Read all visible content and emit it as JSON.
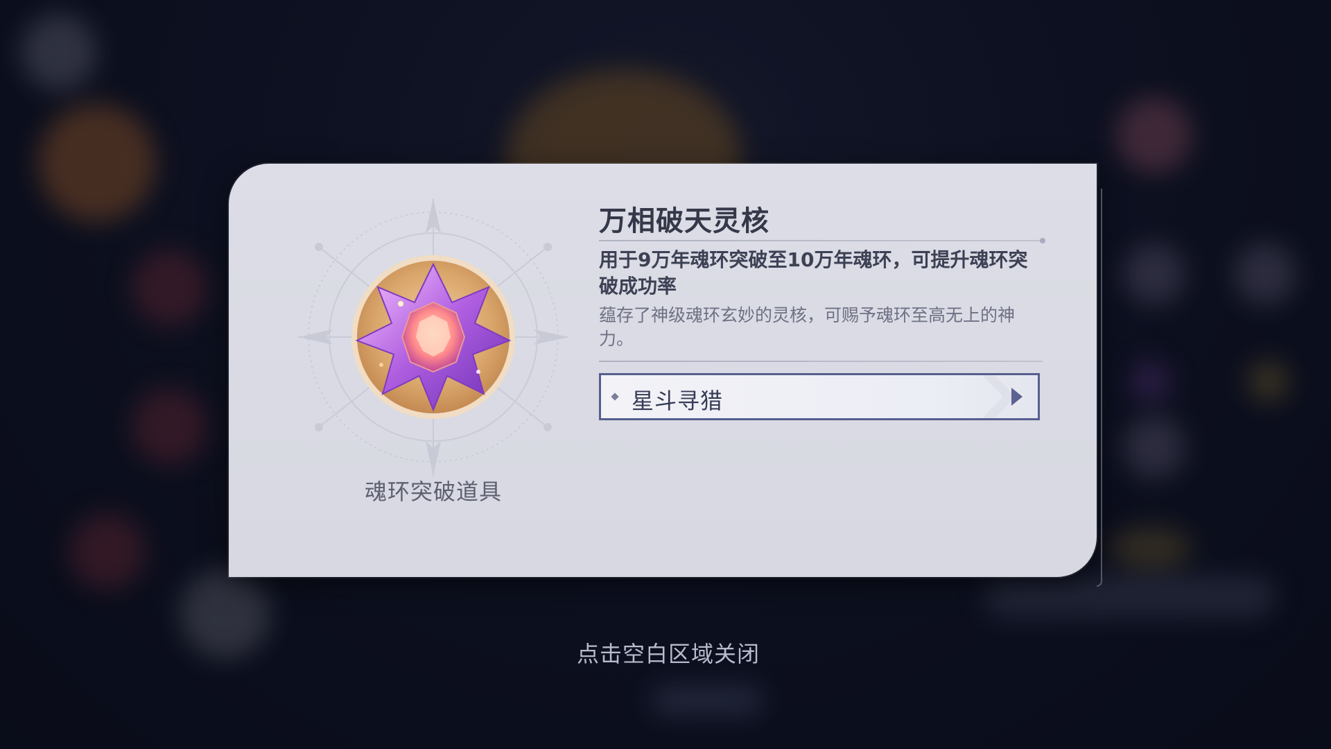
{
  "item": {
    "name": "万相破天灵核",
    "category": "魂环突破道具",
    "effect": "用于9万年魂环突破至10万年魂环，可提升魂环突破成功率",
    "description": "蕴存了神级魂环玄妙的灵核，可赐予魂环至高无上的神力。"
  },
  "sources": [
    {
      "label": "星斗寻猎"
    }
  ],
  "close_hint": "点击空白区域关闭",
  "icons": {
    "item_icon": "purple-crystal-core-icon",
    "source_arrow": "play-arrow-icon",
    "source_bullet": "diamond-bullet-icon"
  },
  "colors": {
    "card_bg": "#dcdde6",
    "title": "#343849",
    "button_border": "#565e8e",
    "crystal": "#b56be0"
  }
}
